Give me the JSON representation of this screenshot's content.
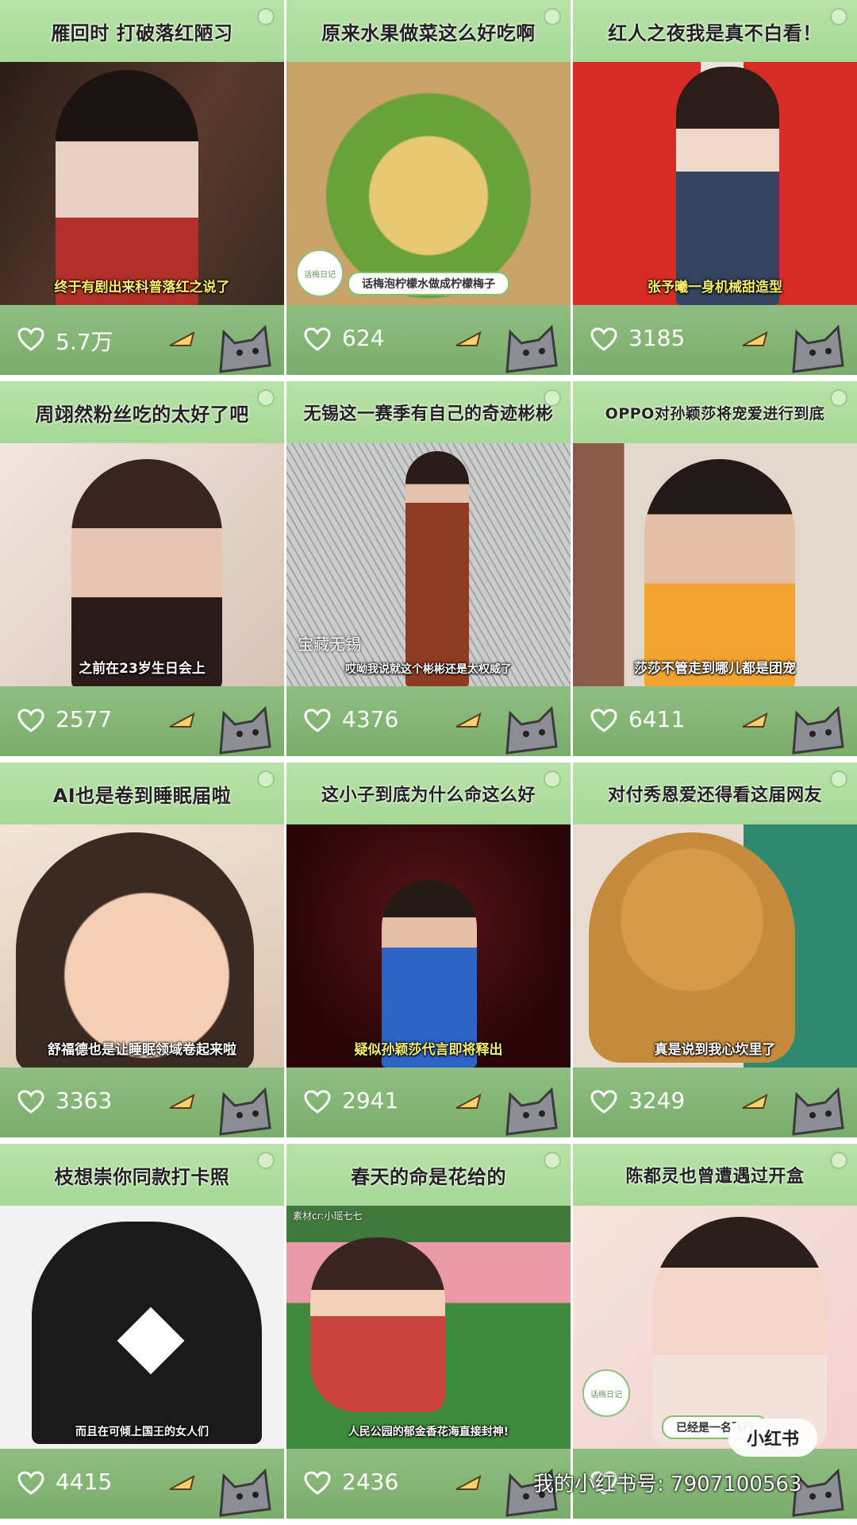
{
  "feed": {
    "cards": [
      {
        "title": "雁回时 打破落红陋习",
        "subtitle": "终于有剧出来科普落红之说了",
        "likes": "5.7万",
        "palette": [
          "#3b2a22",
          "#7a4a36",
          "#b2302a"
        ]
      },
      {
        "title": "原来水果做菜这么好吃啊",
        "subtitle": "话梅泡柠檬水做成柠檬梅子",
        "likes": "624",
        "palette": [
          "#c9a36a",
          "#5e9a33",
          "#a56b4e"
        ]
      },
      {
        "title": "红人之夜我是真不白看！",
        "subtitle": "张予曦一身机械甜造型",
        "likes": "3185",
        "palette": [
          "#d62c25",
          "#2e3b55",
          "#f0ece8"
        ]
      },
      {
        "title": "周翊然粉丝吃的太好了吧",
        "subtitle": "之前在23岁生日会上",
        "likes": "2577",
        "palette": [
          "#3a2724",
          "#d8b9a4",
          "#2a1c1a"
        ]
      },
      {
        "title": "无锡这一赛季有自己的奇迹彬彬",
        "subtitle": "哎呦我说就这个彬彬还是太权威了",
        "likes": "4376",
        "palette": [
          "#bfc3c7",
          "#8f3b22",
          "#3b2a22"
        ]
      },
      {
        "title": "OPPO对孙颖莎将宠爱进行到底",
        "subtitle": "莎莎不管走到哪儿都是团宠",
        "likes": "6411",
        "palette": [
          "#d9cfc3",
          "#f2a22e",
          "#2a2220"
        ]
      },
      {
        "title": "AI也是卷到睡眠届啦",
        "subtitle": "舒福德也是让睡眠领域卷起来啦",
        "likes": "3363",
        "palette": [
          "#e9d6c4",
          "#3a2a22",
          "#f2c9b0"
        ]
      },
      {
        "title": "这小子到底为什么命这么好",
        "subtitle": "疑似孙颖莎代言即将释出",
        "likes": "2941",
        "palette": [
          "#3a0a0c",
          "#2d62c7",
          "#c11a1f"
        ]
      },
      {
        "title": "对付秀恩爱还得看这届网友",
        "subtitle": "真是说到我心坎里了",
        "likes": "3249",
        "palette": [
          "#e7dccf",
          "#c58a3b",
          "#2e8a6f"
        ]
      },
      {
        "title": "枝想崇你同款打卡照",
        "subtitle": "而且在可倾上国王的女人们",
        "likes": "4415",
        "palette": [
          "#f2f2f2",
          "#1a1a1a",
          "#ffffff"
        ]
      },
      {
        "title": "春天的命是花给的",
        "subtitle": "人民公园的郁金香花海直接封神!",
        "likes": "2436",
        "palette": [
          "#3f8a3c",
          "#e99aa6",
          "#c9453b"
        ]
      },
      {
        "title": "陈都灵也曾遭遇过开盒",
        "subtitle": "已经是一名飞行",
        "likes": "",
        "palette": [
          "#f3d6d6",
          "#2a1f1c",
          "#f6e4dc"
        ]
      }
    ]
  },
  "overlays": {
    "watermark_text": "我的小红书号: 7907100563",
    "logo_text": "小红书",
    "stamp_text": "话梅日记",
    "thumb_text_wuxi": "宝藏无锡",
    "thumb_text_source": "素材cr:小瑶七七"
  },
  "colors": {
    "title_bar": "#a7d897",
    "footer": "#7aac6c",
    "card_bg": "#cfe9c2"
  }
}
